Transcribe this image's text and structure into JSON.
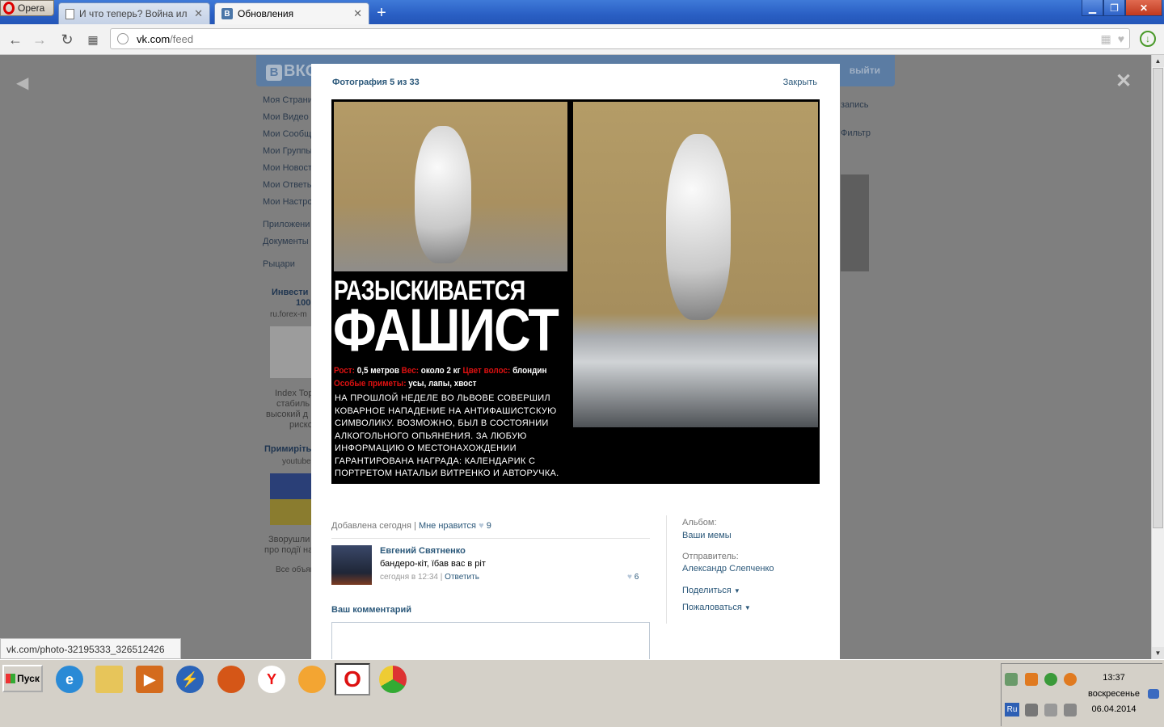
{
  "browser": {
    "menu_label": "Opera",
    "tabs": [
      {
        "label": "И что теперь? Война ил",
        "active": false
      },
      {
        "label": "Обновления",
        "active": true
      }
    ],
    "new_tab": "+",
    "address": {
      "host": "vk.com",
      "path": "/feed"
    },
    "status_url": "vk.com/photo-32195333_326512426"
  },
  "vk_background": {
    "logo": "ВКО",
    "logout": "выйти",
    "menu": [
      "Моя Страни",
      "Мои Видео",
      "Мои Сообщ",
      "Мои Группы",
      "Мои Новост",
      "Мои Ответы",
      "Мои Настро"
    ],
    "menu2": [
      "Приложени",
      "Документы"
    ],
    "menu3": [
      "Рыцари"
    ],
    "ad1": {
      "title_l1": "Инвести",
      "title_l2": "100",
      "source": "ru.forex-m",
      "text_l1": "Index Top",
      "text_l2": "стабиль",
      "text_l3": "высокий д",
      "text_l4": "риско"
    },
    "ad2": {
      "title": "Примиріть",
      "source": "youtube",
      "text_l1": "Зворушли",
      "text_l2": "про події на"
    },
    "all_ads": "Все объяв",
    "right_top": "запись",
    "right_filter": "Фильтр"
  },
  "viewer": {
    "counter": "Фотография 5 из 33",
    "close": "Закрыть",
    "prev_icon": "chevron-left-icon",
    "close_icon": "close-icon"
  },
  "photo": {
    "headline1": "РАЗЫСКИВАЕТСЯ",
    "headline2": "ФАШИСТ",
    "height_label": "Рост:",
    "height_value": "0,5 метров",
    "weight_label": "Вес:",
    "weight_value": "около 2 кг",
    "hair_label": "Цвет волос:",
    "hair_value": "блондин",
    "signs_label": "Особые приметы:",
    "signs_value": "усы, лапы, хвост",
    "description": "НА ПРОШЛОЙ НЕДЕЛЕ ВО ЛЬВОВЕ СОВЕРШИЛ КОВАРНОЕ НАПАДЕНИЕ НА АНТИФАШИСТСКУЮ СИМВОЛИКУ. ВОЗМОЖНО, БЫЛ В СОСТОЯНИИ АЛКОГОЛЬНОГО ОПЬЯНЕНИЯ. ЗА ЛЮБУЮ ИНФОРМАЦИЮ О МЕСТОНАХОЖДЕНИИ ГАРАНТИРОВАНА НАГРАДА: КАЛЕНДАРИК С ПОРТРЕТОМ НАТАЛЬИ ВИТРЕНКО И АВТОРУЧКА."
  },
  "meta": {
    "added": "Добавлена сегодня",
    "separator": "|",
    "like_label": "Мне нравится",
    "like_count": "9"
  },
  "comments": [
    {
      "author": "Евгений Святненко",
      "text": "бандеро-кіт, їбав вас в ріт",
      "time": "сегодня в 12:34",
      "reply": "Ответить",
      "likes": "6"
    }
  ],
  "your_comment_label": "Ваш комментарий",
  "sidebar": {
    "album_label": "Альбом:",
    "album_value": "Ваши мемы",
    "sender_label": "Отправитель:",
    "sender_value": "Александр Слепченко",
    "share": "Поделиться",
    "report": "Пожаловаться"
  },
  "taskbar": {
    "start_label": "Пуск",
    "apps": [
      "internet-explorer-icon",
      "folder-icon",
      "media-player-icon",
      "flash-icon",
      "firefox-icon",
      "yandex-icon",
      "app-icon",
      "opera-icon",
      "chrome-icon"
    ],
    "lang": "Ru",
    "time": "13:37",
    "day": "воскресенье",
    "date": "06.04.2014"
  }
}
